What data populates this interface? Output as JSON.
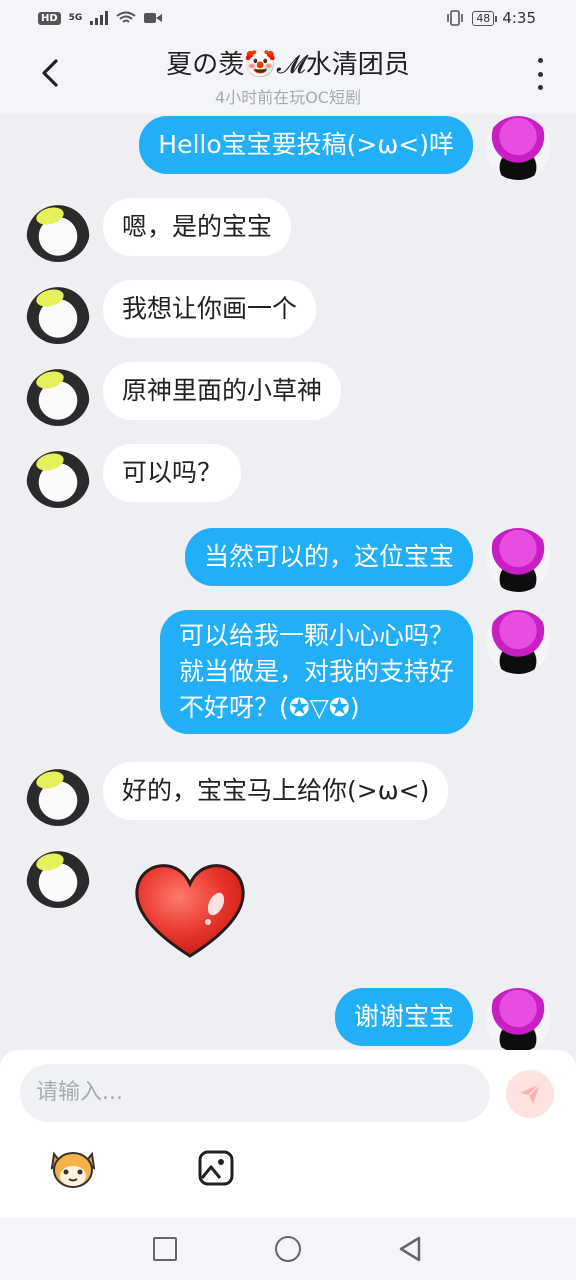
{
  "status_bar": {
    "hd": "HD",
    "signal": "5G",
    "battery": "48",
    "time": "4:35"
  },
  "header": {
    "title": "夏の羡🤡𝓜水清团员",
    "subtitle": "4小时前在玩OC短剧"
  },
  "messages": [
    {
      "side": "out",
      "text": "Hello宝宝要投稿(>ω<)咩"
    },
    {
      "side": "in",
      "text": "嗯，是的宝宝"
    },
    {
      "side": "in",
      "text": "我想让你画一个"
    },
    {
      "side": "in",
      "text": "原神里面的小草神"
    },
    {
      "side": "in",
      "text": "可以吗？"
    },
    {
      "side": "out",
      "text": "当然可以的，这位宝宝"
    },
    {
      "side": "out",
      "lines": [
        "可以给我一颗小心心吗？",
        "就当做是，对我的支持好",
        "不好呀？(✪▽✪)"
      ]
    },
    {
      "side": "in",
      "text": "好的，宝宝马上给你(>ω<)"
    },
    {
      "side": "in",
      "sticker": "heart-sticker"
    },
    {
      "side": "out",
      "text": "谢谢宝宝"
    }
  ],
  "composer": {
    "placeholder": "请输入..."
  },
  "colors": {
    "outgoing_bubble": "#23aef8",
    "incoming_bubble": "#ffffff",
    "background": "#eeeff3"
  }
}
